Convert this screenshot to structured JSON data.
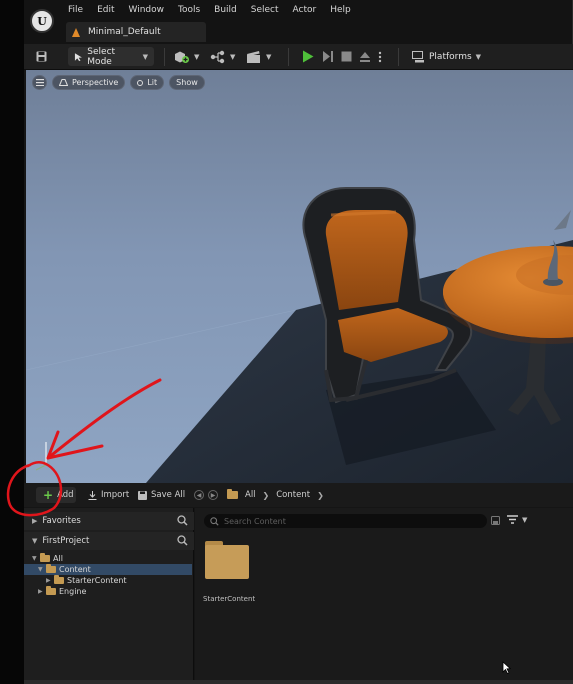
{
  "menubar": {
    "logo": "unreal-engine-logo",
    "items": [
      "File",
      "Edit",
      "Window",
      "Tools",
      "Build",
      "Select",
      "Actor",
      "Help"
    ],
    "level_tab": "Minimal_Default"
  },
  "toolbar": {
    "select_mode": "Select Mode",
    "platforms": "Platforms"
  },
  "viewport": {
    "menu_icon": "hamburger-icon",
    "perspective": "Perspective",
    "lit": "Lit",
    "show": "Show"
  },
  "content_browser": {
    "add": "Add",
    "import": "Import",
    "save_all": "Save All",
    "breadcrumb": [
      "All",
      "Content"
    ],
    "favorites": "Favorites",
    "project": "FirstProject",
    "tree": [
      {
        "label": "All",
        "depth": 0,
        "expanded": true
      },
      {
        "label": "Content",
        "depth": 1,
        "expanded": true,
        "selected": true
      },
      {
        "label": "StarterContent",
        "depth": 2,
        "expanded": false
      },
      {
        "label": "Engine",
        "depth": 1,
        "expanded": false
      }
    ],
    "search_placeholder": "Search Content",
    "assets": [
      {
        "label": "StarterContent",
        "type": "folder"
      }
    ]
  },
  "colors": {
    "accent_green": "#6bcb4a",
    "folder": "#c69c58",
    "selection": "#324a66",
    "annotation_red": "#e0151b"
  }
}
